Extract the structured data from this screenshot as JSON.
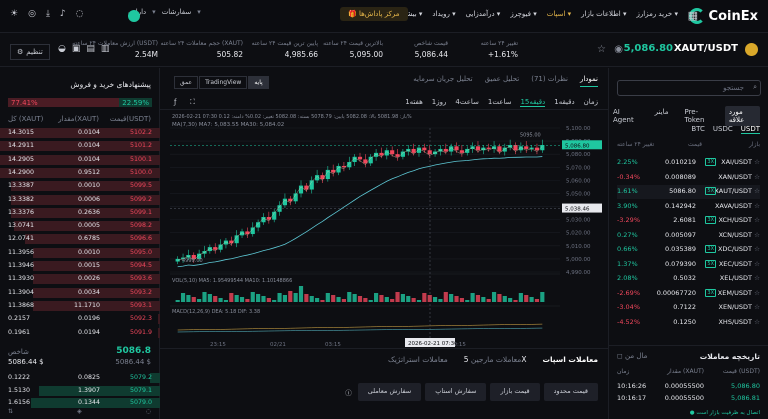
{
  "nav": {
    "logo": "CoinEx",
    "menu": [
      "خرید رمزارز",
      "اطلاعات بازار",
      "اسپات",
      "فیوچرز",
      "درآمدزایی",
      "رویداد",
      "بیشتر"
    ],
    "active_menu": "اسپات",
    "promo": "مرکز پاداش‌ها",
    "user_items": [
      "دارایی",
      "سفارشات"
    ]
  },
  "ticker": {
    "symbol": "XAUT/USDT",
    "price": "5,086.80",
    "stats": [
      {
        "label": "تغییر ۲۴ ساعته",
        "value": "+1.61%",
        "cls": "g"
      },
      {
        "label": "قیمت شاخص",
        "value": "5,086.44",
        "cls": "w"
      },
      {
        "label": "بالاترین قیمت ۲۴ ساعته",
        "value": "5,095.00",
        "cls": "w"
      },
      {
        "label": "پایین ترین قیمت ۲۴ ساعته",
        "value": "4,985.66",
        "cls": "w"
      },
      {
        "label": "حجم معاملات ۲۴ ساعته (XAUT)",
        "value": "505.82",
        "cls": "w"
      },
      {
        "label": "ارزش معاملات ۲۴ ساعته (USDT)",
        "value": "2.54M",
        "cls": "w"
      }
    ],
    "settings_label": "تنظیم"
  },
  "market": {
    "search_placeholder": "جستجو",
    "cats": [
      "مورد علاقه",
      "Pre-Token",
      "ماینر",
      "AI Agent"
    ],
    "active_cat": "مورد علاقه",
    "quotes": [
      "USDT",
      "USDC",
      "BTC"
    ],
    "active_quote": "USDT",
    "headers": [
      "بازار",
      "قیمت",
      "تغییر ۲۴ ساعته"
    ],
    "rows": [
      {
        "pair": "XAI/USDT",
        "lev": "3X",
        "price": "0.010219",
        "chg": "2.25%",
        "up": true
      },
      {
        "pair": "XAN/USDT",
        "lev": "",
        "price": "0.008089",
        "chg": "-0.34%",
        "up": false
      },
      {
        "pair": "XAUT/USDT",
        "lev": "5X",
        "price": "5086.80",
        "chg": "1.61%",
        "up": true
      },
      {
        "pair": "XAVA/USDT",
        "lev": "",
        "price": "0.142942",
        "chg": "3.90%",
        "up": true
      },
      {
        "pair": "XCH/USDT",
        "lev": "3X",
        "price": "2.6081",
        "chg": "-3.29%",
        "up": false
      },
      {
        "pair": "XCN/USDT",
        "lev": "",
        "price": "0.005097",
        "chg": "0.27%",
        "up": true
      },
      {
        "pair": "XDC/USDT",
        "lev": "3X",
        "price": "0.035389",
        "chg": "0.66%",
        "up": true
      },
      {
        "pair": "XEC/USDT",
        "lev": "5X",
        "price": "0.079390",
        "chg": "1.37%",
        "up": true
      },
      {
        "pair": "XEL/USDT",
        "lev": "",
        "price": "0.5032",
        "chg": "2.08%",
        "up": true
      },
      {
        "pair": "XEM/USDT",
        "lev": "3X",
        "price": "0.00067720",
        "chg": "-2.69%",
        "up": false
      },
      {
        "pair": "XEN/USDT",
        "lev": "",
        "price": "0.7122",
        "chg": "-3.04%",
        "up": false
      },
      {
        "pair": "XHS/USDT",
        "lev": "",
        "price": "0.1250",
        "chg": "-4.52%",
        "up": false
      }
    ]
  },
  "history": {
    "title": "تاریخچه معاملات",
    "mine": "مال من",
    "headers": [
      "قیمت (USDT)",
      "مقدار (XAUT)",
      "زمان"
    ],
    "rows": [
      {
        "price": "5,086.80",
        "amount": "0.00055500",
        "time": "10:16:26"
      },
      {
        "price": "5,086.81",
        "amount": "0.00055500",
        "time": "10:16:17"
      }
    ],
    "footer": "اتصال به ظرفیت بازار است"
  },
  "chart": {
    "tabs": [
      "نمودار",
      "سفارشات",
      "تحلیل عمیق",
      "تحلیل جریان سرمایه"
    ],
    "active_tab": "نمودار",
    "tab_count": "نظرات (71)",
    "timeframes": [
      "زمان",
      "1دقیقه",
      "15دقیقه",
      "1ساعت",
      "4ساعت",
      "1روز",
      "1هفته"
    ],
    "active_tf": "15دقیقه",
    "views": [
      "پایه",
      "TradingView",
      "عمق"
    ],
    "active_view": "پایه",
    "info": "2026-02-21 07:30  باز: 5081.98  بالا: 5082.08  پایین: 5078.79  بسته: 5082.08  تغییر: 0.02%  دامنه: 0.12%",
    "ma": "MA(7,30)  MA7: 5,083.55  MA30: 5,084.02",
    "vol": "VOL(5,10)  MA5: 1.95499544  MA10: 1.10148866",
    "macd": "MACD(12,26,9)  DEA: 5.18  DIF: 3.38",
    "cursor_label": "2026-02-21 07:30",
    "yaxis": [
      "5,100.00",
      "5,090.00",
      "5,080.00",
      "5,070.00",
      "5,060.00",
      "5,050.00",
      "5,040.00",
      "5,030.00",
      "5,020.00",
      "5,010.00",
      "5,000.00",
      "4,990.00"
    ],
    "last_price_tag": "5,086.80",
    "cursor_price_tag": "5,038.46",
    "high_note": "5095.00",
    "low_note": "4999.00",
    "xaxis": [
      "23:15",
      "02/21",
      "03:15",
      "",
      "09:15"
    ],
    "closes": [
      5000,
      5001,
      5003,
      5000,
      5004,
      5006,
      5009,
      5007,
      5011,
      5014,
      5012,
      5018,
      5021,
      5019,
      5024,
      5028,
      5032,
      5030,
      5036,
      5041,
      5046,
      5044,
      5050,
      5056,
      5053,
      5060,
      5064,
      5061,
      5068,
      5066,
      5071,
      5070,
      5074,
      5078,
      5076,
      5073,
      5078,
      5081,
      5079,
      5083,
      5080,
      5078,
      5082,
      5084,
      5081,
      5085,
      5083,
      5080,
      5082,
      5084,
      5082,
      5086,
      5083,
      5081,
      5084,
      5086,
      5083,
      5085,
      5084,
      5086,
      5082,
      5085,
      5087,
      5083,
      5086,
      5084,
      5085,
      5083,
      5087
    ]
  },
  "orderbook": {
    "title": "پیشنهادهای خرید و فروش",
    "buy_pct": "22.59%",
    "sell_pct": "77.41%",
    "headers": [
      "قیمت(USDT)",
      "مقدار(XAUT)",
      "کل (XAUT)"
    ],
    "asks": [
      [
        "5102.2",
        "0.0104",
        "14.3015"
      ],
      [
        "5101.2",
        "0.0104",
        "14.2911"
      ],
      [
        "5100.1",
        "0.0104",
        "14.2905"
      ],
      [
        "5100.0",
        "0.9512",
        "14.2900"
      ],
      [
        "5099.5",
        "0.0010",
        "13.3387"
      ],
      [
        "5099.2",
        "0.0006",
        "13.3382"
      ],
      [
        "5099.1",
        "0.2636",
        "13.3376"
      ],
      [
        "5098.2",
        "0.0005",
        "13.0741"
      ],
      [
        "5096.6",
        "0.6785",
        "12.0741"
      ],
      [
        "5095.0",
        "0.0010",
        "11.3956"
      ],
      [
        "5094.5",
        "0.0015",
        "11.3946"
      ],
      [
        "5093.6",
        "0.0026",
        "11.3930"
      ],
      [
        "5093.2",
        "0.0034",
        "11.3904"
      ],
      [
        "5093.1",
        "11.1710",
        "11.3868"
      ],
      [
        "5092.3",
        "0.0196",
        "0.2157"
      ],
      [
        "5091.9",
        "0.0194",
        "0.1961"
      ]
    ],
    "mid": "5086.8",
    "mid_usd": "5086.44 $",
    "mid_label": "شاخص",
    "bids": [
      [
        "5079.2",
        "0.0825",
        "0.1222"
      ],
      [
        "5079.1",
        "1.3907",
        "1.5130"
      ],
      [
        "5079.0",
        "0.1344",
        "1.6156"
      ]
    ]
  },
  "trade": {
    "tabs": [
      "معاملات اسپات",
      "معاملات مارجین",
      "معاملات استراتژیک"
    ],
    "active": "معاملات اسپات",
    "margin_lev": "5X",
    "order_types": [
      "قیمت محدود",
      "قیمت بازار",
      "سفارش استاپ",
      "سفارش معاملی"
    ]
  },
  "colors": {
    "green": "#1fc7a0",
    "red": "#f0475c",
    "gold": "#e7b84b"
  }
}
